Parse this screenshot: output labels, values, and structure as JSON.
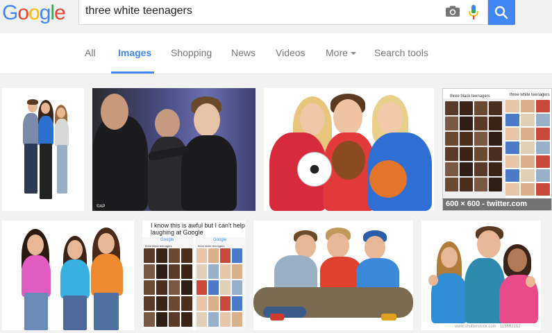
{
  "header": {
    "logo_letters": [
      "G",
      "o",
      "o",
      "g",
      "l",
      "e"
    ],
    "logo_colors": [
      "#4285f4",
      "#ea4335",
      "#fbbc05",
      "#4285f4",
      "#34a853",
      "#ea4335"
    ],
    "query": "three white teenagers",
    "camera_icon": "camera-icon",
    "mic_icon": "microphone-icon",
    "search_icon": "search-icon"
  },
  "tabs": {
    "items": [
      "All",
      "Images",
      "Shopping",
      "News",
      "Videos",
      "More",
      "Search tools"
    ],
    "active": "Images",
    "accent": "#4285f4"
  },
  "results": {
    "twitter_caption": "600 × 600 - twitter.com",
    "ap_mark": "©AP",
    "tweet_left_query": "three black teenagers",
    "tweet_right_query": "three white teenagers",
    "meme_text": "I know this is awful but I can't help laughing at Google",
    "meme_left_query": "three black teenagers",
    "meme_right_query": "three white teenagers",
    "shutterstock_footer": "www.shutterstock.com · 115592152"
  }
}
